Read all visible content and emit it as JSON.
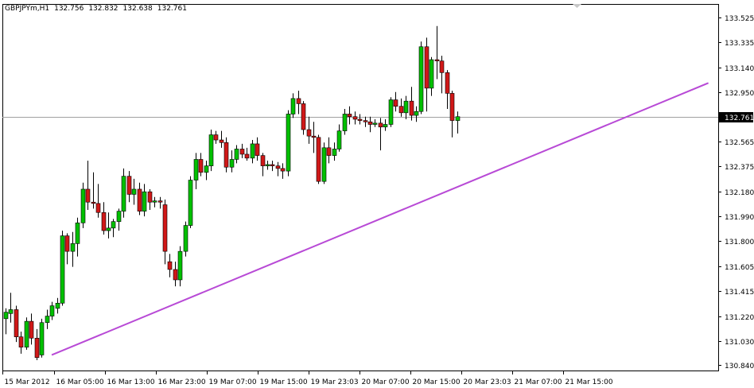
{
  "window": {
    "symbol": "GBPJPYm,H1",
    "ohlc": [
      "132.756",
      "132.832",
      "132.638",
      "132.761"
    ]
  },
  "colors": {
    "background": "#ffffff",
    "bull": "#00c000",
    "bear": "#d01818",
    "wick": "#000000",
    "trendline": "#b84ad6",
    "price_line": "#a0a0a0",
    "price_label_bg": "#000000",
    "price_label_text": "#ffffff"
  },
  "chart_data": {
    "type": "candlestick",
    "symbol": "GBPJPYm",
    "timeframe": "H1",
    "current_price": "132.761",
    "ylim": [
      130.8,
      133.63
    ],
    "y_ticks": [
      "133.525",
      "133.335",
      "133.140",
      "132.950",
      "132.761",
      "132.565",
      "132.375",
      "132.180",
      "131.990",
      "131.800",
      "131.605",
      "131.415",
      "131.220",
      "131.030",
      "130.840"
    ],
    "x_ticks": [
      "15 Mar 2012",
      "16 Mar 05:00",
      "16 Mar 13:00",
      "16 Mar 23:00",
      "19 Mar 07:00",
      "19 Mar 15:00",
      "19 Mar 23:03",
      "20 Mar 07:00",
      "20 Mar 15:00",
      "20 Mar 23:03",
      "21 Mar 07:00",
      "21 Mar 15:00"
    ],
    "trendline": {
      "start": {
        "bar": 9,
        "price": 130.92
      },
      "end": {
        "bar": 137,
        "price": 133.02
      }
    },
    "candles": [
      {
        "o": 131.2,
        "h": 131.28,
        "l": 131.08,
        "c": 131.25
      },
      {
        "o": 131.24,
        "h": 131.4,
        "l": 131.17,
        "c": 131.27
      },
      {
        "o": 131.27,
        "h": 131.3,
        "l": 131.02,
        "c": 131.06
      },
      {
        "o": 131.06,
        "h": 131.1,
        "l": 130.93,
        "c": 130.98
      },
      {
        "o": 130.98,
        "h": 131.21,
        "l": 130.96,
        "c": 131.18
      },
      {
        "o": 131.18,
        "h": 131.24,
        "l": 131.0,
        "c": 131.05
      },
      {
        "o": 131.05,
        "h": 131.12,
        "l": 130.88,
        "c": 130.9
      },
      {
        "o": 130.92,
        "h": 131.2,
        "l": 130.9,
        "c": 131.17
      },
      {
        "o": 131.17,
        "h": 131.27,
        "l": 131.12,
        "c": 131.22
      },
      {
        "o": 131.22,
        "h": 131.33,
        "l": 131.19,
        "c": 131.3
      },
      {
        "o": 131.28,
        "h": 131.36,
        "l": 131.24,
        "c": 131.32
      },
      {
        "o": 131.32,
        "h": 131.88,
        "l": 131.3,
        "c": 131.84
      },
      {
        "o": 131.84,
        "h": 131.86,
        "l": 131.62,
        "c": 131.72
      },
      {
        "o": 131.72,
        "h": 131.87,
        "l": 131.6,
        "c": 131.78
      },
      {
        "o": 131.78,
        "h": 131.98,
        "l": 131.68,
        "c": 131.94
      },
      {
        "o": 131.94,
        "h": 132.25,
        "l": 131.9,
        "c": 132.2
      },
      {
        "o": 132.2,
        "h": 132.42,
        "l": 132.04,
        "c": 132.1
      },
      {
        "o": 132.1,
        "h": 132.33,
        "l": 132.05,
        "c": 132.09
      },
      {
        "o": 132.09,
        "h": 132.24,
        "l": 131.98,
        "c": 132.02
      },
      {
        "o": 132.02,
        "h": 132.1,
        "l": 131.85,
        "c": 131.88
      },
      {
        "o": 131.88,
        "h": 132.02,
        "l": 131.82,
        "c": 131.9
      },
      {
        "o": 131.9,
        "h": 131.97,
        "l": 131.83,
        "c": 131.95
      },
      {
        "o": 131.95,
        "h": 132.05,
        "l": 131.88,
        "c": 132.03
      },
      {
        "o": 132.03,
        "h": 132.36,
        "l": 131.98,
        "c": 132.3
      },
      {
        "o": 132.3,
        "h": 132.34,
        "l": 132.1,
        "c": 132.16
      },
      {
        "o": 132.16,
        "h": 132.28,
        "l": 132.08,
        "c": 132.2
      },
      {
        "o": 132.2,
        "h": 132.25,
        "l": 132.0,
        "c": 132.03
      },
      {
        "o": 132.03,
        "h": 132.24,
        "l": 131.99,
        "c": 132.18
      },
      {
        "o": 132.18,
        "h": 132.2,
        "l": 132.04,
        "c": 132.1
      },
      {
        "o": 132.1,
        "h": 132.14,
        "l": 132.06,
        "c": 132.11
      },
      {
        "o": 132.11,
        "h": 132.14,
        "l": 132.05,
        "c": 132.1
      },
      {
        "o": 132.08,
        "h": 132.12,
        "l": 131.62,
        "c": 131.72
      },
      {
        "o": 131.64,
        "h": 131.7,
        "l": 131.52,
        "c": 131.58
      },
      {
        "o": 131.58,
        "h": 131.64,
        "l": 131.45,
        "c": 131.5
      },
      {
        "o": 131.5,
        "h": 131.76,
        "l": 131.45,
        "c": 131.72
      },
      {
        "o": 131.72,
        "h": 131.95,
        "l": 131.68,
        "c": 131.92
      },
      {
        "o": 131.92,
        "h": 132.3,
        "l": 131.9,
        "c": 132.27
      },
      {
        "o": 132.27,
        "h": 132.48,
        "l": 132.2,
        "c": 132.43
      },
      {
        "o": 132.43,
        "h": 132.48,
        "l": 132.3,
        "c": 132.33
      },
      {
        "o": 132.33,
        "h": 132.42,
        "l": 132.27,
        "c": 132.38
      },
      {
        "o": 132.38,
        "h": 132.66,
        "l": 132.34,
        "c": 132.62
      },
      {
        "o": 132.62,
        "h": 132.65,
        "l": 132.55,
        "c": 132.58
      },
      {
        "o": 132.58,
        "h": 132.65,
        "l": 132.52,
        "c": 132.56
      },
      {
        "o": 132.56,
        "h": 132.6,
        "l": 132.33,
        "c": 132.37
      },
      {
        "o": 132.37,
        "h": 132.5,
        "l": 132.33,
        "c": 132.43
      },
      {
        "o": 132.43,
        "h": 132.54,
        "l": 132.4,
        "c": 132.51
      },
      {
        "o": 132.51,
        "h": 132.55,
        "l": 132.44,
        "c": 132.47
      },
      {
        "o": 132.47,
        "h": 132.52,
        "l": 132.42,
        "c": 132.44
      },
      {
        "o": 132.44,
        "h": 132.58,
        "l": 132.4,
        "c": 132.55
      },
      {
        "o": 132.55,
        "h": 132.6,
        "l": 132.42,
        "c": 132.46
      },
      {
        "o": 132.46,
        "h": 132.48,
        "l": 132.3,
        "c": 132.38
      },
      {
        "o": 132.38,
        "h": 132.42,
        "l": 132.35,
        "c": 132.39
      },
      {
        "o": 132.39,
        "h": 132.42,
        "l": 132.34,
        "c": 132.38
      },
      {
        "o": 132.38,
        "h": 132.41,
        "l": 132.3,
        "c": 132.36
      },
      {
        "o": 132.36,
        "h": 132.4,
        "l": 132.28,
        "c": 132.34
      },
      {
        "o": 132.34,
        "h": 132.81,
        "l": 132.3,
        "c": 132.78
      },
      {
        "o": 132.78,
        "h": 132.94,
        "l": 132.75,
        "c": 132.9
      },
      {
        "o": 132.9,
        "h": 132.96,
        "l": 132.78,
        "c": 132.86
      },
      {
        "o": 132.86,
        "h": 132.88,
        "l": 132.62,
        "c": 132.66
      },
      {
        "o": 132.66,
        "h": 132.76,
        "l": 132.55,
        "c": 132.61
      },
      {
        "o": 132.61,
        "h": 132.72,
        "l": 132.48,
        "c": 132.6
      },
      {
        "o": 132.6,
        "h": 132.62,
        "l": 132.24,
        "c": 132.26
      },
      {
        "o": 132.26,
        "h": 132.56,
        "l": 132.24,
        "c": 132.52
      },
      {
        "o": 132.52,
        "h": 132.6,
        "l": 132.4,
        "c": 132.46
      },
      {
        "o": 132.46,
        "h": 132.56,
        "l": 132.42,
        "c": 132.51
      },
      {
        "o": 132.51,
        "h": 132.7,
        "l": 132.49,
        "c": 132.65
      },
      {
        "o": 132.65,
        "h": 132.82,
        "l": 132.62,
        "c": 132.78
      },
      {
        "o": 132.78,
        "h": 132.84,
        "l": 132.7,
        "c": 132.76
      },
      {
        "o": 132.76,
        "h": 132.8,
        "l": 132.7,
        "c": 132.74
      },
      {
        "o": 132.74,
        "h": 132.78,
        "l": 132.7,
        "c": 132.73
      },
      {
        "o": 132.73,
        "h": 132.76,
        "l": 132.68,
        "c": 132.72
      },
      {
        "o": 132.72,
        "h": 132.76,
        "l": 132.64,
        "c": 132.7
      },
      {
        "o": 132.7,
        "h": 132.74,
        "l": 132.68,
        "c": 132.71
      },
      {
        "o": 132.71,
        "h": 132.75,
        "l": 132.5,
        "c": 132.68
      },
      {
        "o": 132.68,
        "h": 132.74,
        "l": 132.65,
        "c": 132.7
      },
      {
        "o": 132.7,
        "h": 132.91,
        "l": 132.68,
        "c": 132.89
      },
      {
        "o": 132.89,
        "h": 132.95,
        "l": 132.8,
        "c": 132.84
      },
      {
        "o": 132.84,
        "h": 132.9,
        "l": 132.76,
        "c": 132.79
      },
      {
        "o": 132.79,
        "h": 132.92,
        "l": 132.74,
        "c": 132.88
      },
      {
        "o": 132.88,
        "h": 132.99,
        "l": 132.73,
        "c": 132.77
      },
      {
        "o": 132.77,
        "h": 132.84,
        "l": 132.72,
        "c": 132.8
      },
      {
        "o": 132.8,
        "h": 133.34,
        "l": 132.78,
        "c": 133.3
      },
      {
        "o": 133.3,
        "h": 133.37,
        "l": 132.8,
        "c": 132.98
      },
      {
        "o": 132.98,
        "h": 133.22,
        "l": 132.92,
        "c": 133.2
      },
      {
        "o": 133.2,
        "h": 133.46,
        "l": 133.05,
        "c": 133.19
      },
      {
        "o": 133.19,
        "h": 133.23,
        "l": 132.94,
        "c": 133.1
      },
      {
        "o": 133.1,
        "h": 133.12,
        "l": 132.82,
        "c": 132.94
      },
      {
        "o": 132.94,
        "h": 132.96,
        "l": 132.6,
        "c": 132.73
      },
      {
        "o": 132.73,
        "h": 132.8,
        "l": 132.63,
        "c": 132.76
      }
    ]
  }
}
